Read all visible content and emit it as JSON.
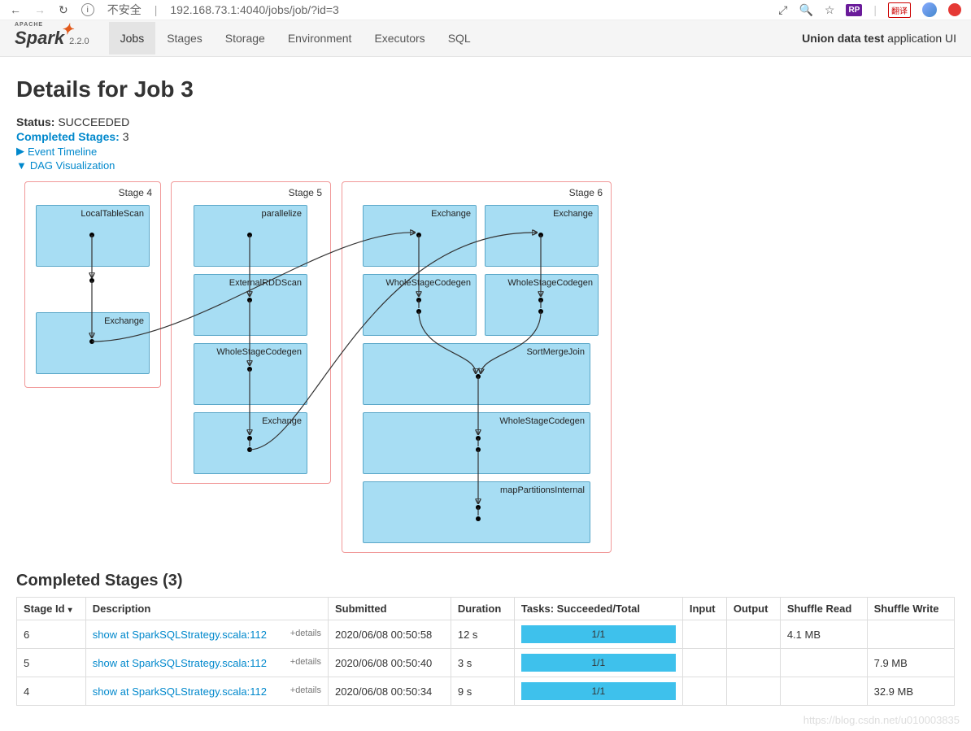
{
  "browser": {
    "url_insecure_label": "不安全",
    "url": "192.168.73.1:4040/jobs/job/?id=3",
    "rp_badge": "RP",
    "lang_badge": "翻译"
  },
  "nav": {
    "brand_apache": "APACHE",
    "brand_name": "Spark",
    "version": "2.2.0",
    "tabs": [
      "Jobs",
      "Stages",
      "Storage",
      "Environment",
      "Executors",
      "SQL"
    ],
    "active_tab": "Jobs",
    "app_title_bold": "Union data test",
    "app_title_rest": "application UI"
  },
  "page": {
    "title": "Details for Job 3",
    "status_label": "Status:",
    "status_value": "SUCCEEDED",
    "completed_label": "Completed Stages:",
    "completed_value": "3",
    "toggle_event": "Event Timeline",
    "toggle_dag": "DAG Visualization"
  },
  "dag": {
    "stages": [
      {
        "id": "4",
        "title": "Stage 4",
        "nodes": [
          "LocalTableScan",
          "Exchange"
        ]
      },
      {
        "id": "5",
        "title": "Stage 5",
        "nodes": [
          "parallelize",
          "ExternalRDDScan",
          "WholeStageCodegen",
          "Exchange"
        ]
      },
      {
        "id": "6",
        "title": "Stage 6",
        "nodes": [
          "Exchange",
          "Exchange",
          "WholeStageCodegen",
          "WholeStageCodegen",
          "SortMergeJoin",
          "WholeStageCodegen",
          "mapPartitionsInternal"
        ]
      }
    ]
  },
  "completed": {
    "heading": "Completed Stages (3)",
    "cols": [
      "Stage Id",
      "Description",
      "Submitted",
      "Duration",
      "Tasks: Succeeded/Total",
      "Input",
      "Output",
      "Shuffle Read",
      "Shuffle Write"
    ],
    "sort_glyph": "▾",
    "details_label": "+details",
    "rows": [
      {
        "id": "6",
        "desc": "show at SparkSQLStrategy.scala:112",
        "submitted": "2020/06/08 00:50:58",
        "dur": "12 s",
        "tasks": "1/1",
        "input": "",
        "output": "",
        "sr": "4.1 MB",
        "sw": ""
      },
      {
        "id": "5",
        "desc": "show at SparkSQLStrategy.scala:112",
        "submitted": "2020/06/08 00:50:40",
        "dur": "3 s",
        "tasks": "1/1",
        "input": "",
        "output": "",
        "sr": "",
        "sw": "7.9 MB"
      },
      {
        "id": "4",
        "desc": "show at SparkSQLStrategy.scala:112",
        "submitted": "2020/06/08 00:50:34",
        "dur": "9 s",
        "tasks": "1/1",
        "input": "",
        "output": "",
        "sr": "",
        "sw": "32.9 MB"
      }
    ]
  },
  "watermark": "https://blog.csdn.net/u010003835"
}
